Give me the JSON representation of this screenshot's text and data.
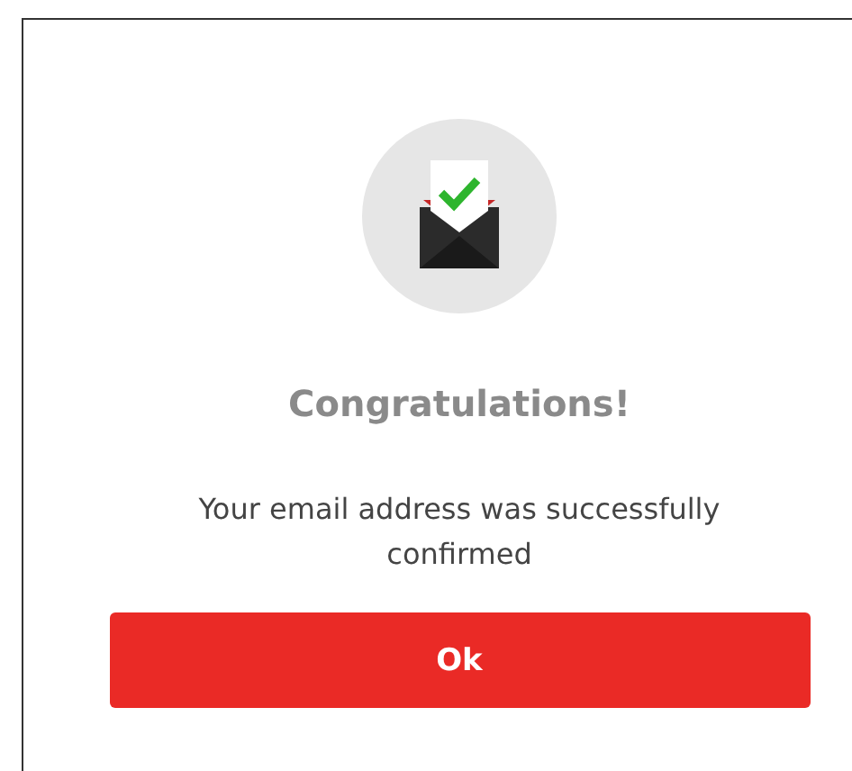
{
  "dialog": {
    "title": "Congratulations!",
    "message": "Your email address was successfully confirmed",
    "button": "Ok"
  }
}
